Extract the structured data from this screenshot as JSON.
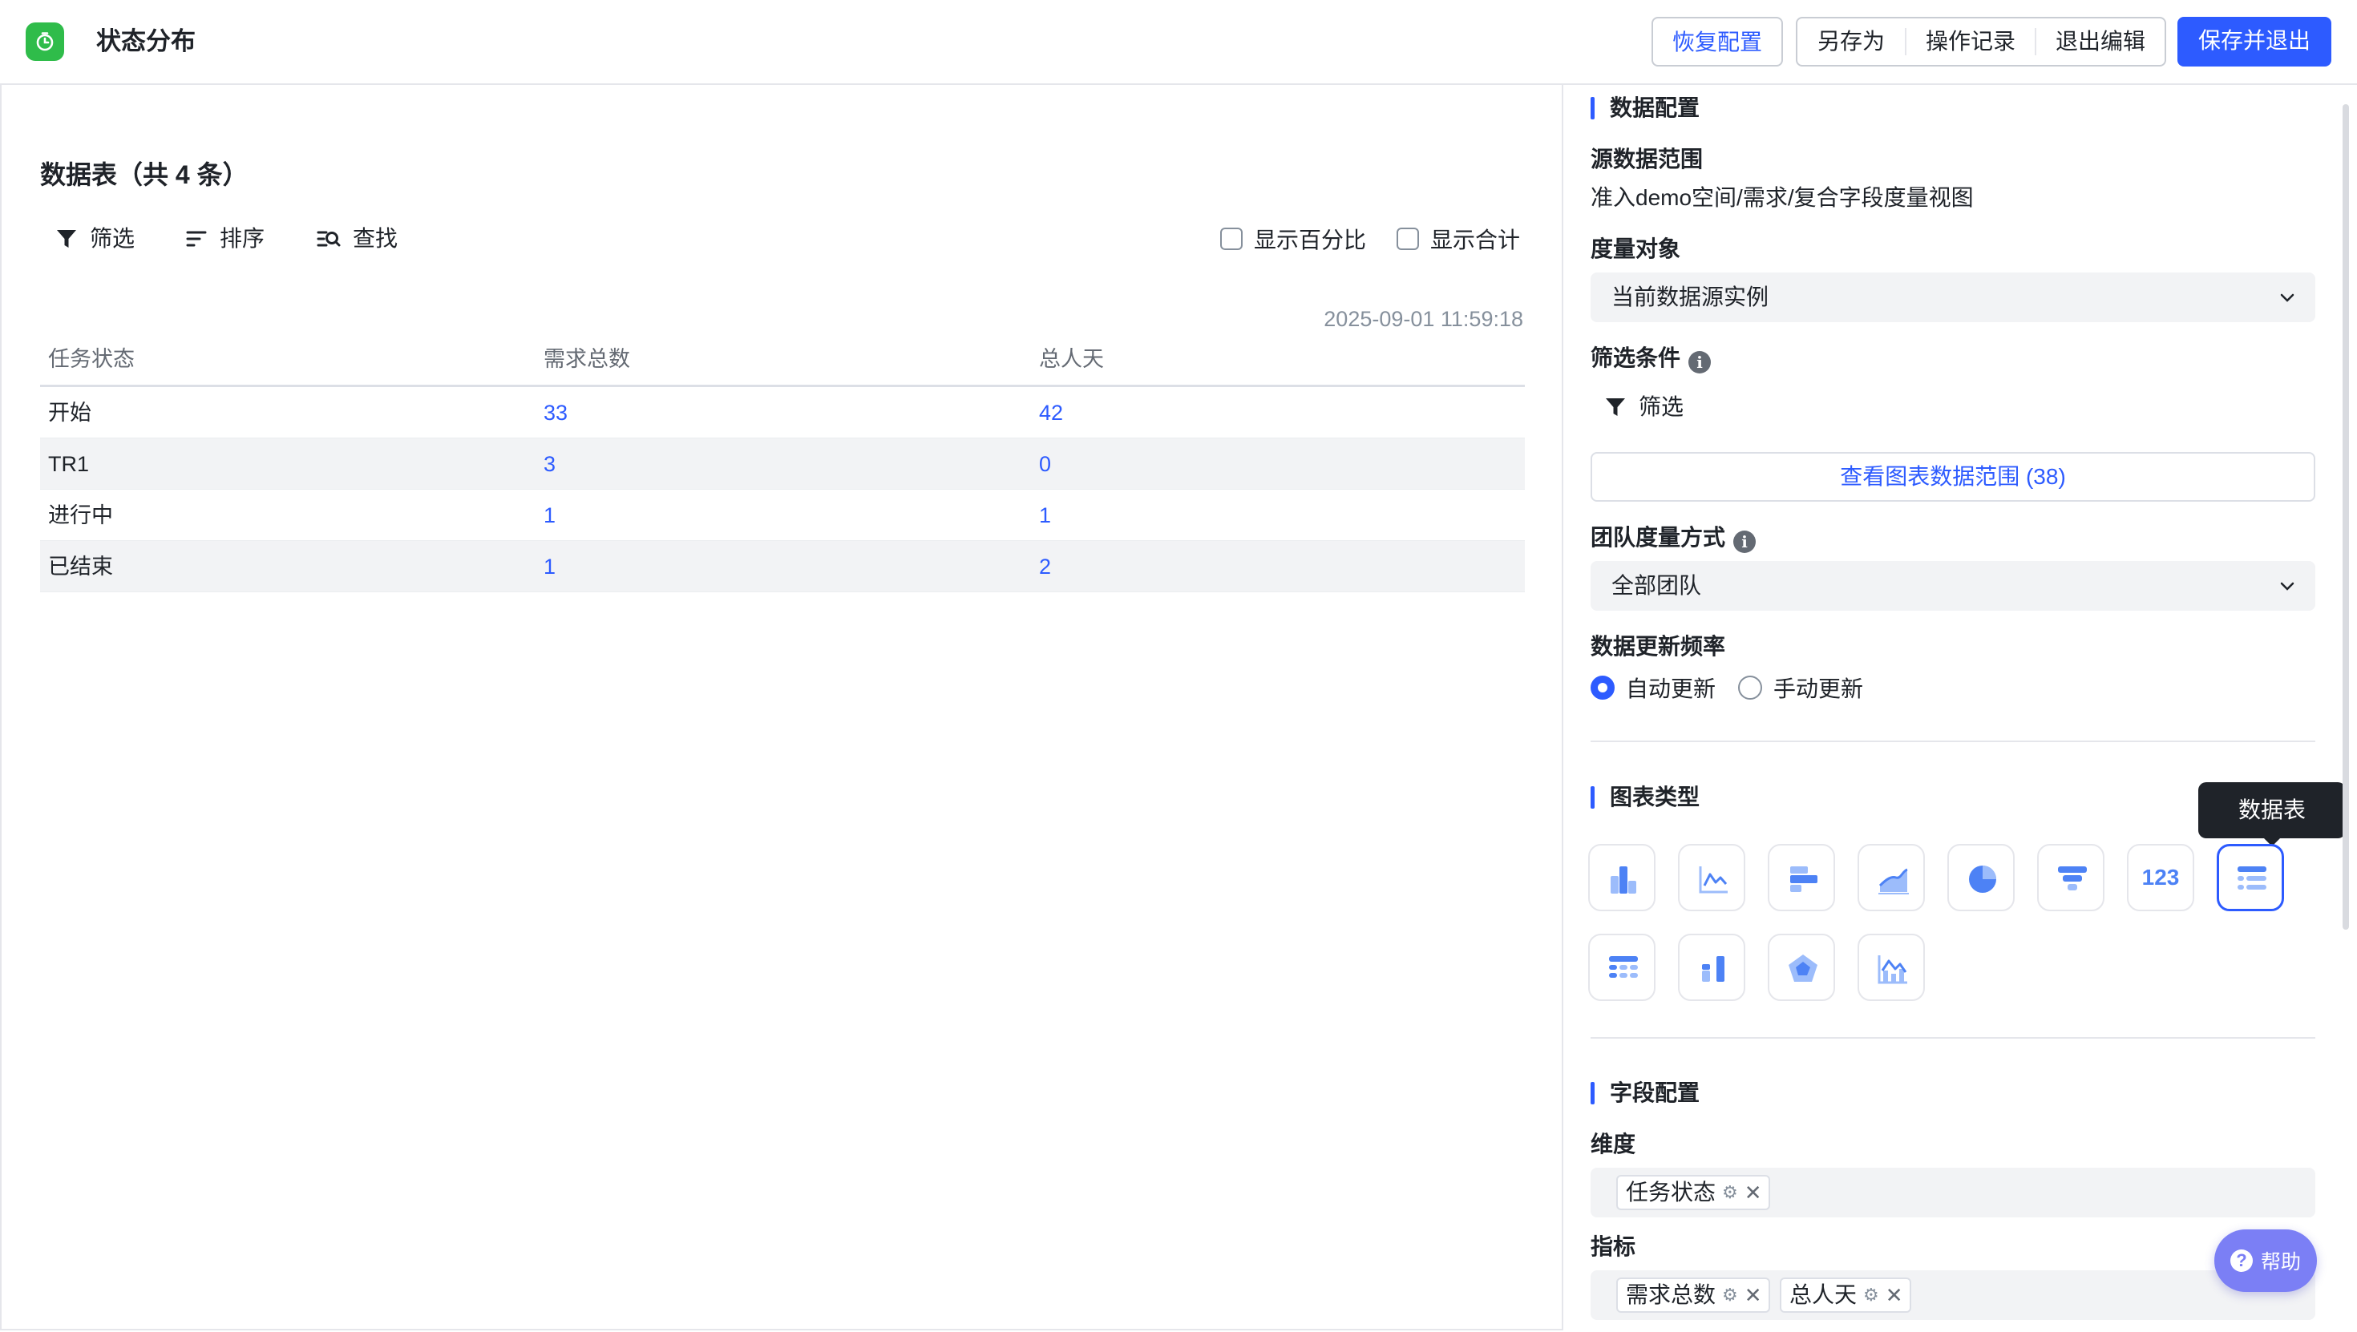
{
  "header": {
    "title": "状态分布",
    "restore_label": "恢复配置",
    "save_as_label": "另存为",
    "history_label": "操作记录",
    "exit_edit_label": "退出编辑",
    "save_exit_label": "保存并退出",
    "accent": "#2d5bff",
    "logo_color": "#2fbc4a"
  },
  "table_panel": {
    "title": "数据表（共 4 条）",
    "toolbar": {
      "filter": "筛选",
      "sort": "排序",
      "find": "查找"
    },
    "show_percent": "显示百分比",
    "show_total": "显示合计",
    "timestamp": "2025-09-01 11:59:18",
    "columns": [
      "任务状态",
      "需求总数",
      "总人天"
    ],
    "rows": [
      [
        "开始",
        "33",
        "42"
      ],
      [
        "TR1",
        "3",
        "0"
      ],
      [
        "进行中",
        "1",
        "1"
      ],
      [
        "已结束",
        "1",
        "2"
      ]
    ]
  },
  "config": {
    "data_section": "数据配置",
    "source_label": "源数据范围",
    "source_value": "准入demo空间/需求/复合字段度量视图",
    "measure_label": "度量对象",
    "measure_value": "当前数据源实例",
    "filter_label": "筛选条件",
    "filter_button": "筛选",
    "view_range_button": "查看图表数据范围 (38)",
    "team_label": "团队度量方式",
    "team_value": "全部团队",
    "freq_label": "数据更新频率",
    "freq_auto": "自动更新",
    "freq_manual": "手动更新",
    "chart_type_section": "图表类型",
    "chart_tooltip": "数据表",
    "chart_types": [
      "bar-chart-icon",
      "line-chart-icon",
      "horizontal-bar-icon",
      "area-chart-icon",
      "pie-chart-icon",
      "funnel-icon",
      "number-card-icon",
      "data-table-icon",
      "pivot-table-icon",
      "stacked-bar-icon",
      "radar-chart-icon",
      "combo-chart-icon"
    ],
    "number_card_text": "123",
    "field_section": "字段配置",
    "dimension_label": "维度",
    "dimension_tags": [
      "任务状态"
    ],
    "metric_label": "指标",
    "metric_tags": [
      "需求总数",
      "总人天"
    ],
    "help_label": "帮助"
  }
}
